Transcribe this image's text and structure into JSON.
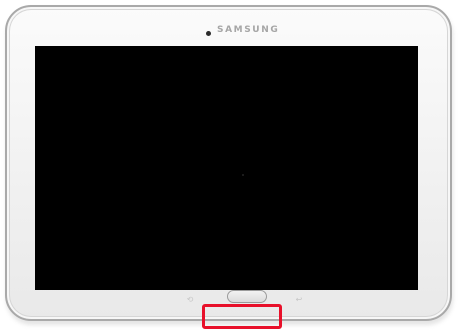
{
  "device": {
    "brand_label": "SAMSUNG",
    "screen_state": "off",
    "frame_color": "#f3f3f3",
    "screen_color": "#000000"
  },
  "nav_keys": {
    "recent_icon": "recent-apps-icon",
    "recent_glyph": "⟲",
    "back_icon": "back-icon",
    "back_glyph": "↩"
  },
  "annotation": {
    "highlight_color": "#e8102a",
    "highlighted_element": "home-button"
  }
}
